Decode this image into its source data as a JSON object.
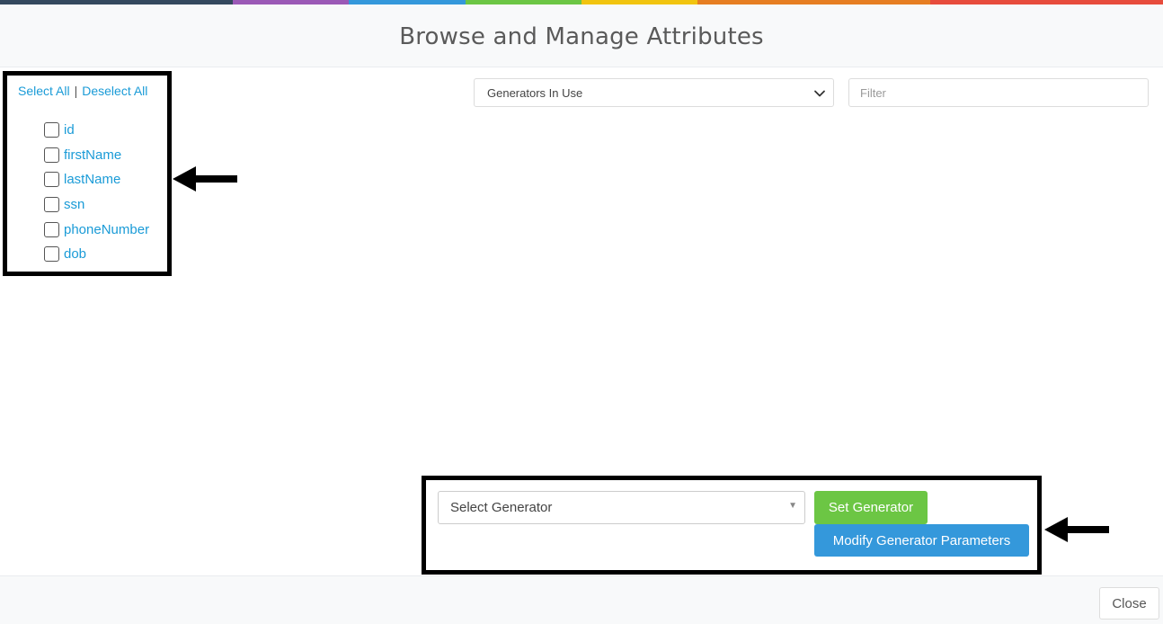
{
  "colors": {
    "top_bar": [
      "#34495e",
      "#9b59b6",
      "#3498db",
      "#6cc644",
      "#f1c40f",
      "#e67e22",
      "#e74c3c"
    ],
    "link": "#1a9bd7",
    "set_button": "#6cc644",
    "modify_button": "#3498db"
  },
  "header": {
    "title": "Browse and Manage Attributes"
  },
  "selection": {
    "select_all": "Select All",
    "separator": "|",
    "deselect_all": "Deselect All"
  },
  "attributes": [
    {
      "label": "id",
      "checked": false
    },
    {
      "label": "firstName",
      "checked": false
    },
    {
      "label": "lastName",
      "checked": false
    },
    {
      "label": "ssn",
      "checked": false
    },
    {
      "label": "phoneNumber",
      "checked": false
    },
    {
      "label": "dob",
      "checked": false
    }
  ],
  "toolbar": {
    "generators_dropdown": "Generators In Use",
    "filter_placeholder": "Filter"
  },
  "generator_panel": {
    "select_placeholder": "Select Generator",
    "set_button": "Set Generator",
    "modify_button": "Modify Generator Parameters"
  },
  "footer": {
    "close_button": "Close"
  },
  "icons": {
    "chevron": "chevron-down-icon",
    "caret": "caret-down-icon",
    "arrow": "arrow-left-icon"
  }
}
